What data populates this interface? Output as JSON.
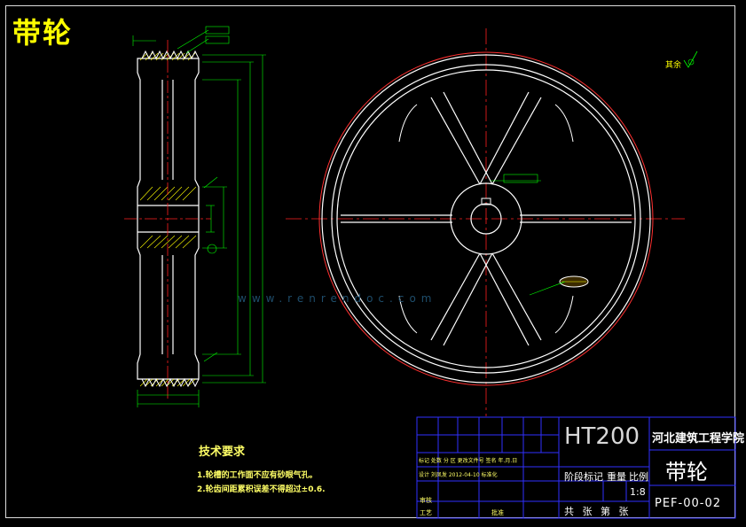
{
  "drawing_title": "带轮",
  "roughness_note": "其余",
  "tech_requirements": {
    "title": "技术要求",
    "items": [
      "1.轮槽的工作面不应有砂眼气孔。",
      "2.轮齿间距累积误差不得超过±0.6."
    ]
  },
  "title_block": {
    "material": "HT200",
    "company": "河北建筑工程学院",
    "part_name": "带轮",
    "drawing_number": "PEF-00-02",
    "scale": "1:8",
    "stage_label": "阶段标记",
    "weight_label": "重量",
    "scale_label": "比例",
    "sheets_label": "共 张 第 张",
    "revision_row": "标记 处数 分 区 更改文件号 签名 年.月.日",
    "design_row": "设计  刘凤发  2012-04-10  标准化",
    "review_label": "审核",
    "process_label": "工艺",
    "approve_label": "批准"
  },
  "watermark": "www.renrendoc.com",
  "colors": {
    "background": "#000000",
    "outline": "#ffffff",
    "center_line": "#ff2020",
    "dimension": "#00ff00",
    "title_yellow": "#ffff00",
    "hatch": "#ffff00",
    "title_block_line": "#3030ff"
  }
}
